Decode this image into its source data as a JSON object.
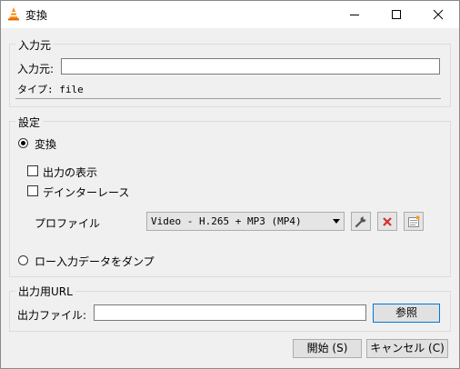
{
  "window": {
    "title": "変換",
    "icons": [
      "vlc-cone-icon",
      "minimize-icon",
      "maximize-icon",
      "close-icon"
    ]
  },
  "source": {
    "group_label": "入力元",
    "input_label": "入力元:",
    "input_value": "                              ",
    "type_label": "タイプ: file"
  },
  "settings": {
    "group_label": "設定",
    "convert_label": "変換",
    "show_output_label": "出力の表示",
    "deinterlace_label": "デインターレース",
    "profile_label": "プロファイル",
    "profile_value": "Video - H.265 + MP3 (MP4)",
    "dump_raw_label": "ロー入力データをダンプ",
    "convert_selected": true,
    "show_output_checked": false,
    "deinterlace_checked": false
  },
  "output": {
    "group_label": "出力用URL",
    "file_label": "出力ファイル:",
    "file_value": "                                            ",
    "browse_label": "参照"
  },
  "footer": {
    "start_label": "開始 (S)",
    "cancel_label": "キャンセル (C)"
  },
  "colors": {
    "accent_border": "#0078d7",
    "delete_red": "#d32f2f",
    "vlc_orange": "#ff8800"
  }
}
